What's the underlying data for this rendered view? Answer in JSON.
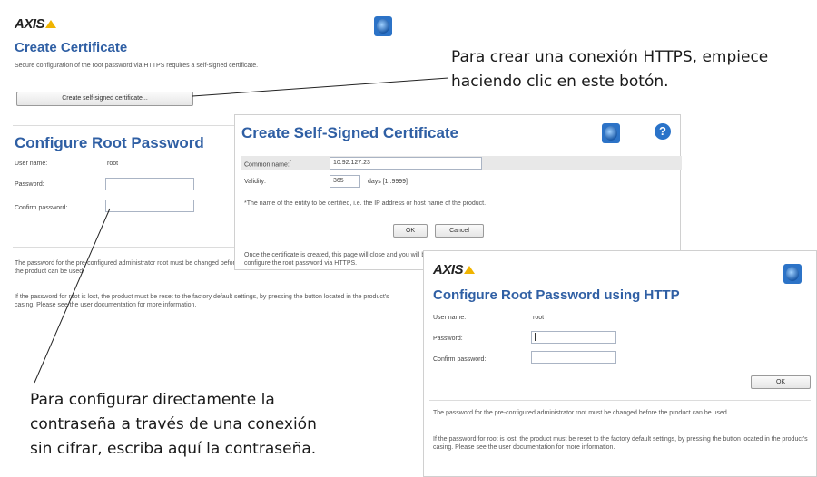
{
  "logo_text": "AXIS",
  "create_certificate": {
    "title": "Create Certificate",
    "description": "Secure configuration of the root password via HTTPS requires a self-signed certificate.",
    "button_label": "Create self-signed certificate..."
  },
  "configure_root_password": {
    "title": "Configure Root Password",
    "user_name_label": "User name:",
    "user_name_value": "root",
    "password_label": "Password:",
    "confirm_label": "Confirm password:",
    "note_1": "The password for the pre-configured administrator root must be changed before the product can be used.",
    "note_2": "If the password for root is lost, the product must be reset to the factory default settings, by pressing the button located in the product's casing. Please see the user documentation for more information."
  },
  "self_signed_dialog": {
    "title": "Create Self-Signed Certificate",
    "help_icon_glyph": "?",
    "common_name_label": "Common name:",
    "common_name_marker": "*",
    "common_name_value": "10.92.127.23",
    "validity_label": "Validity:",
    "validity_value": "365",
    "validity_unit": "days [1..9999]",
    "footnote": "*The name of the entity to be certified, i.e. the IP address or host name of the product.",
    "ok_label": "OK",
    "cancel_label": "Cancel",
    "info": "Once the certificate is created, this page will close and you will be able to configure the root password via HTTPS."
  },
  "http_password_dialog": {
    "title": "Configure Root Password using HTTP",
    "user_name_label": "User name:",
    "user_name_value": "root",
    "password_label": "Password:",
    "confirm_label": "Confirm password:",
    "ok_label": "OK",
    "note_1": "The password for the pre-configured administrator root must be changed before the product can be used.",
    "note_2": "If the password for root is lost, the product must be reset to the factory default settings, by pressing the button located in the product's casing. Please see the user documentation for more information."
  },
  "callouts": {
    "https_line1": "Para crear una conexión HTTPS, empiece",
    "https_line2": "haciendo clic en este botón.",
    "http_line1": "Para configurar directamente la",
    "http_line2": "contraseña a través de una conexión",
    "http_line3": "sin cifrar, escriba aquí la contraseña."
  },
  "colors": {
    "title_blue": "#2f5fa4",
    "accent_yellow": "#f0b400",
    "globe_blue": "#2c73c7"
  },
  "icons": [
    "axis-logo",
    "globe-icon",
    "help-icon"
  ]
}
